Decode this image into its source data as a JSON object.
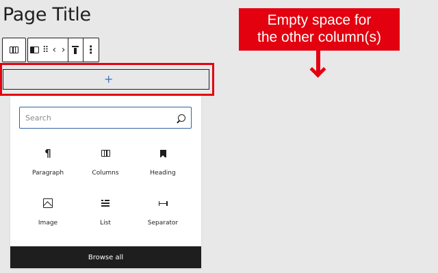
{
  "page": {
    "title": "Page Title"
  },
  "block_inserter": {
    "search": {
      "placeholder": "Search",
      "value": ""
    },
    "blocks": [
      {
        "label": "Paragraph",
        "icon": "paragraph-icon"
      },
      {
        "label": "Columns",
        "icon": "columns-icon"
      },
      {
        "label": "Heading",
        "icon": "heading-icon"
      },
      {
        "label": "Image",
        "icon": "image-icon"
      },
      {
        "label": "List",
        "icon": "list-icon"
      },
      {
        "label": "Separator",
        "icon": "separator-icon"
      }
    ],
    "browse_all_label": "Browse all"
  },
  "add_block": {
    "label": "+"
  },
  "annotation": {
    "line1": "Empty space for",
    "line2": "the other column(s)",
    "color": "#e3000f"
  },
  "colors": {
    "accent": "#3a74c4",
    "highlight": "#e3000f",
    "dark": "#1e1e1e"
  }
}
